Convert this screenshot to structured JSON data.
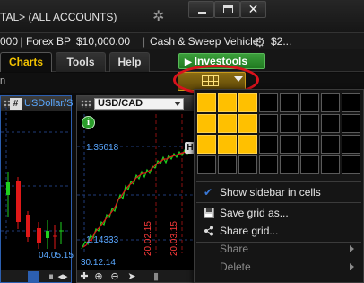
{
  "window": {
    "title": "TAL> (ALL ACCOUNTS)",
    "close_glyph": "✕"
  },
  "summary": {
    "account_value": "000",
    "forex_label": "Forex BP",
    "forex_value": "$10,000.00",
    "cash_label": "Cash & Sweep Vehicle",
    "cash_value": "$2..."
  },
  "tabs": [
    {
      "label": "Charts",
      "active": true
    },
    {
      "label": "Tools",
      "active": false
    },
    {
      "label": "Help",
      "active": false
    }
  ],
  "investools": {
    "label": "Investools"
  },
  "toolbar": {
    "row_letter": "n"
  },
  "left_chart": {
    "hash": "#",
    "symbol": "USDollar/S",
    "date": "04.05.15"
  },
  "right_chart": {
    "symbol": "USD/CAD",
    "info": "i",
    "price_high": "1.35018",
    "price_low": "1.14333",
    "h_badge": "H",
    "dates": [
      "20.02.15",
      "20.03.15"
    ],
    "footer_date": "30.12.14"
  },
  "grid_menu": {
    "rows": 4,
    "cols": 8,
    "selected_rows": 3,
    "selected_cols": 3,
    "accent_color": "#ffc000",
    "items": [
      {
        "label": "Show sidebar in cells",
        "icon": "check-icon",
        "glyph": "✔",
        "disabled": false,
        "submenu": false
      },
      {
        "label": "Save grid as...",
        "icon": "save-icon",
        "glyph": "",
        "disabled": false,
        "submenu": false
      },
      {
        "label": "Share grid...",
        "icon": "share-icon",
        "glyph": "",
        "disabled": false,
        "submenu": false
      },
      {
        "label": "Share",
        "icon": "",
        "glyph": "",
        "disabled": true,
        "submenu": true
      },
      {
        "label": "Delete",
        "icon": "",
        "glyph": "",
        "disabled": true,
        "submenu": true
      }
    ]
  }
}
